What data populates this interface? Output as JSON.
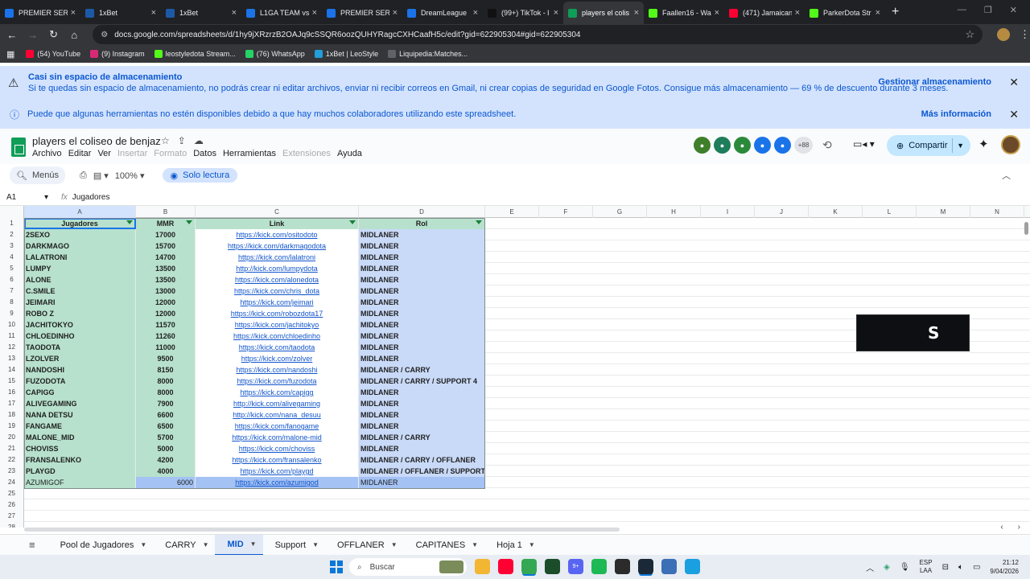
{
  "browser": {
    "tabs": [
      {
        "title": "PREMIER SERIE",
        "color": "#1a73e8",
        "icon": "arrow-icon",
        "active": false
      },
      {
        "title": "1xBet",
        "color": "#1c5aa8",
        "icon": "1xbet-icon",
        "active": false
      },
      {
        "title": "1xBet",
        "color": "#1c5aa8",
        "icon": "1xbet-icon",
        "active": false
      },
      {
        "title": "L1GA TEAM vs",
        "color": "#1a73e8",
        "icon": "arrow-icon",
        "active": false
      },
      {
        "title": "PREMIER SERIE",
        "color": "#1a73e8",
        "icon": "arrow-icon",
        "active": false
      },
      {
        "title": "DreamLeague",
        "color": "#1a73e8",
        "icon": "arrow-icon",
        "active": false
      },
      {
        "title": "(99+) TikTok - l",
        "color": "#111111",
        "icon": "tiktok-icon",
        "active": false
      },
      {
        "title": "players el colis",
        "color": "#0f9d58",
        "icon": "sheets-icon",
        "active": true
      },
      {
        "title": "Faallen16 - Wa",
        "color": "#53fc18",
        "icon": "kick-icon",
        "active": false
      },
      {
        "title": "(471) Jamaican",
        "color": "#ff0033",
        "icon": "youtube-icon",
        "active": false
      },
      {
        "title": "ParkerDota Str",
        "color": "#53fc18",
        "icon": "kick-icon",
        "active": false
      }
    ],
    "url": "docs.google.com/spreadsheets/d/1hy9jXRzrzB2OAJq9cSSQR6oozQUHYRagcCXHCaafH5c/edit?gid=622905304#gid=622905304",
    "bookmarks": [
      {
        "label": "(54) YouTube",
        "color": "#ff0033"
      },
      {
        "label": "(9) Instagram",
        "color": "#d62976"
      },
      {
        "label": "leostyledota Stream...",
        "color": "#53fc18"
      },
      {
        "label": "(76) WhatsApp",
        "color": "#25d366"
      },
      {
        "label": "1xBet | LeoStyle",
        "color": "#229ed9"
      },
      {
        "label": "Liquipedia:Matches...",
        "color": "#5f6368"
      }
    ]
  },
  "banners": {
    "storage_title": "Casi sin espacio de almacenamiento",
    "storage_text": "Si te quedas sin espacio de almacenamiento, no podrás crear ni editar archivos, enviar ni recibir correos en Gmail, ni crear copias de seguridad en Google Fotos. Consigue más almacenamiento — 69 % de descuento durante 3 meses.",
    "storage_action": "Gestionar almacenamiento",
    "collab_text": "Puede que algunas herramientas no estén disponibles debido a que hay muchos colaboradores utilizando este spreadsheet.",
    "collab_action": "Más información"
  },
  "doc": {
    "title": "players el coliseo de benjaz",
    "menu": [
      {
        "label": "Archivo",
        "enabled": true
      },
      {
        "label": "Editar",
        "enabled": true
      },
      {
        "label": "Ver",
        "enabled": true
      },
      {
        "label": "Insertar",
        "enabled": false
      },
      {
        "label": "Formato",
        "enabled": false
      },
      {
        "label": "Datos",
        "enabled": true
      },
      {
        "label": "Herramientas",
        "enabled": true
      },
      {
        "label": "Extensiones",
        "enabled": false
      },
      {
        "label": "Ayuda",
        "enabled": true
      }
    ],
    "collaborators": [
      {
        "color": "#3f7f2a"
      },
      {
        "color": "#1e7d5a"
      },
      {
        "color": "#2a8a3a"
      },
      {
        "color": "#1a73e8"
      },
      {
        "color": "#1a73e8"
      }
    ],
    "more_collaborators": "+88",
    "share_label": "Compartir"
  },
  "toolbar": {
    "menus_label": "Menús",
    "zoom": "100%",
    "readonly_label": "Solo lectura"
  },
  "formula": {
    "cell_ref": "A1",
    "content": "Jugadores"
  },
  "grid": {
    "columns": [
      "A",
      "B",
      "C",
      "D",
      "E",
      "F",
      "G",
      "H",
      "I",
      "J",
      "K",
      "L",
      "M",
      "N"
    ],
    "headers": {
      "a": "Jugadores",
      "b": "MMR",
      "c": "Link",
      "d": "Rol"
    },
    "rows": [
      {
        "a": "2SEXO",
        "b": "17000",
        "c": "https://kick.com/ositodoto",
        "d": "MIDLANER"
      },
      {
        "a": "DARKMAGO",
        "b": "15700",
        "c": "https://kick.com/darkmagodota",
        "d": "MIDLANER"
      },
      {
        "a": "LALATRONI",
        "b": "14700",
        "c": "https://kick.com/lalatroni",
        "d": "MIDLANER"
      },
      {
        "a": "LUMPY",
        "b": "13500",
        "c": "http://kick.com/lumpydota",
        "d": "MIDLANER"
      },
      {
        "a": "ALONE",
        "b": "13500",
        "c": "https://kick.com/alonedota",
        "d": "MIDLANER"
      },
      {
        "a": "C.SMILE",
        "b": "13000",
        "c": "https://kick.com/chris_dota",
        "d": "MIDLANER"
      },
      {
        "a": "JEIMARI",
        "b": "12000",
        "c": "https://kick.com/jeimari",
        "d": "MIDLANER"
      },
      {
        "a": "ROBO Z",
        "b": "12000",
        "c": "https://kick.com/robozdota17",
        "d": "MIDLANER"
      },
      {
        "a": "JACHITOKYO",
        "b": "11570",
        "c": "https://kick.com/jachitokyo",
        "d": "MIDLANER"
      },
      {
        "a": "CHLOEDINHO",
        "b": "11260",
        "c": "https://kick.com/chloedinho",
        "d": "MIDLANER"
      },
      {
        "a": "TAODOTA",
        "b": "11000",
        "c": "https://kick.com/taodota",
        "d": "MIDLANER"
      },
      {
        "a": "LZOLVER",
        "b": "9500",
        "c": "https://kick.com/zolver",
        "d": "MIDLANER"
      },
      {
        "a": "NANDOSHI",
        "b": "8150",
        "c": "https://kick.com/nandoshi",
        "d": "MIDLANER / CARRY"
      },
      {
        "a": "FUZODOTA",
        "b": "8000",
        "c": "https://kick.com/fuzodota",
        "d": "MIDLANER / CARRY / SUPPORT 4"
      },
      {
        "a": "CAPIGG",
        "b": "8000",
        "c": "https://kick.com/capigg",
        "d": "MIDLANER"
      },
      {
        "a": "ALIVEGAMING",
        "b": "7900",
        "c": "http://kick.com/alivegaming",
        "d": "MIDLANER"
      },
      {
        "a": "NANA DETSU",
        "b": "6600",
        "c": "http://kick.com/nana_desuu",
        "d": "MIDLANER"
      },
      {
        "a": "FANGAME",
        "b": "6500",
        "c": "https://kick.com/fanogame",
        "d": "MIDLANER"
      },
      {
        "a": "MALONE_MID",
        "b": "5700",
        "c": "https://kick.com/malone-mid",
        "d": "MIDLANER / CARRY"
      },
      {
        "a": "CHOVISS",
        "b": "5000",
        "c": "https://kick.com/choviss",
        "d": "MIDLANER"
      },
      {
        "a": "FRANSALENKO",
        "b": "4200",
        "c": "https://kick.com/fransalenko",
        "d": "MIDLANER / CARRY / OFFLANER"
      },
      {
        "a": "PLAYGD",
        "b": "4000",
        "c": "https://kick.com/playgd",
        "d": "MIDLANER / OFFLANER / SUPPORT"
      },
      {
        "a": "AZUMIGOF",
        "b": "6000",
        "c": "https://kick.com/azumigod",
        "d": "MIDLANER"
      }
    ],
    "empty_rows": [
      "25",
      "26",
      "27",
      "28"
    ]
  },
  "sheet_tabs": [
    {
      "label": "Pool de Jugadores",
      "active": false
    },
    {
      "label": "CARRY",
      "active": false
    },
    {
      "label": "MID",
      "active": true
    },
    {
      "label": "Support",
      "active": false
    },
    {
      "label": "OFFLANER",
      "active": false
    },
    {
      "label": "CAPITANES",
      "active": false
    },
    {
      "label": "Hoja 1",
      "active": false
    }
  ],
  "taskbar": {
    "search_placeholder": "Buscar",
    "apps": [
      {
        "name": "file-explorer-icon",
        "color": "#f2b632"
      },
      {
        "name": "youtube-app-icon",
        "color": "#ff0033"
      },
      {
        "name": "chrome-icon",
        "color": "#34a853"
      },
      {
        "name": "terminal-icon",
        "color": "#1b4d2a"
      },
      {
        "name": "discord-icon",
        "color": "#5865f2",
        "badge": "9+"
      },
      {
        "name": "spotify-icon",
        "color": "#1db954"
      },
      {
        "name": "obs-icon",
        "color": "#2b2b2b"
      },
      {
        "name": "steam-icon",
        "color": "#1b2838"
      },
      {
        "name": "calculator-icon",
        "color": "#3b6fb6"
      },
      {
        "name": "notepad-icon",
        "color": "#1a9fe0"
      }
    ],
    "language_line1": "ESP",
    "language_line2": "LAA",
    "time": "21:12",
    "date": "9/04/2026"
  }
}
